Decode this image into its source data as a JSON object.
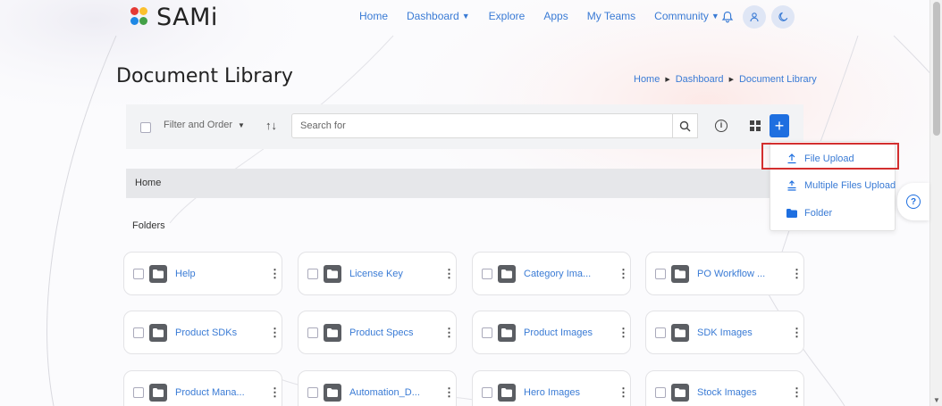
{
  "app": {
    "name": "SAMi"
  },
  "nav": {
    "items": [
      {
        "label": "Home",
        "dropdown": false
      },
      {
        "label": "Dashboard",
        "dropdown": true
      },
      {
        "label": "Explore",
        "dropdown": false
      },
      {
        "label": "Apps",
        "dropdown": false
      },
      {
        "label": "My Teams",
        "dropdown": false
      },
      {
        "label": "Community",
        "dropdown": true
      }
    ],
    "icons": [
      "bell-icon",
      "user-icon",
      "moon-icon"
    ]
  },
  "page": {
    "title": "Document Library"
  },
  "breadcrumb": [
    "Home",
    "Dashboard",
    "Document Library"
  ],
  "toolbar": {
    "filter_label": "Filter and Order",
    "search_placeholder": "Search for"
  },
  "location_bar": "Home",
  "folders_label": "Folders",
  "folders": [
    "Help",
    "License Key",
    "Category Ima...",
    "PO Workflow ...",
    "Product SDKs",
    "Product Specs",
    "Product Images",
    "SDK Images",
    "Product Mana...",
    "Automation_D...",
    "Hero Images",
    "Stock Images"
  ],
  "upload_menu": {
    "items": [
      {
        "label": "File Upload",
        "icon": "upload-icon",
        "highlighted": true
      },
      {
        "label": "Multiple Files Upload",
        "icon": "multi-upload-icon",
        "highlighted": false
      },
      {
        "label": "Folder",
        "icon": "folder-icon",
        "highlighted": false
      }
    ]
  },
  "colors": {
    "accent": "#1e6fe0",
    "link": "#3a7bd5",
    "highlight_border": "#d32f2f",
    "folder_icon": "#5b5e63"
  }
}
